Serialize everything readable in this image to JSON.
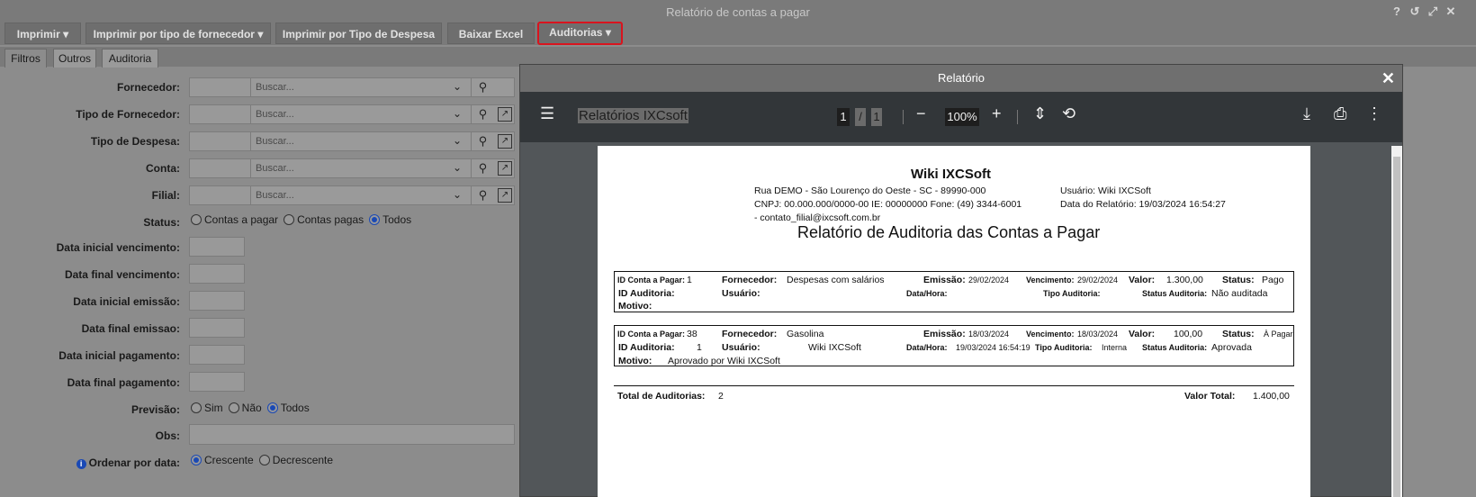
{
  "window": {
    "title": "Relatório de contas a pagar"
  },
  "toolbar": {
    "imprimir": "Imprimir",
    "imprimir_fornecedor": "Imprimir por tipo de fornecedor",
    "imprimir_despesa": "Imprimir por Tipo de Despesa",
    "baixar_excel": "Baixar Excel",
    "auditorias": "Auditorias"
  },
  "tabs": [
    "Filtros",
    "Outros",
    "Auditoria"
  ],
  "filters": {
    "fornecedor": "Fornecedor:",
    "tipo_fornecedor": "Tipo de Fornecedor:",
    "tipo_despesa": "Tipo de Despesa:",
    "conta": "Conta:",
    "filial": "Filial:",
    "placeholder": "Buscar...",
    "status": "Status:",
    "status_opts": [
      "Contas a pagar",
      "Contas pagas",
      "Todos"
    ],
    "data_ini_venc": "Data inicial vencimento:",
    "data_fin_venc": "Data final vencimento:",
    "data_ini_emis": "Data inicial emissão:",
    "data_fin_emis": "Data final emissao:",
    "data_ini_pag": "Data inicial pagamento:",
    "data_fin_pag": "Data final pagamento:",
    "previsao": "Previsão:",
    "previsao_opts": [
      "Sim",
      "Não",
      "Todos"
    ],
    "obs": "Obs:",
    "ordenar": "Ordenar por data:",
    "ordenar_opts": [
      "Crescente",
      "Decrescente"
    ]
  },
  "modal": {
    "title": "Relatório",
    "pdf_title": "Relatórios IXCsoft",
    "page_current": "1",
    "page_sep": "/",
    "page_total": "1",
    "zoom": "100%"
  },
  "report": {
    "company": "Wiki IXCSoft",
    "address": "Rua DEMO - São Lourenço do Oeste - SC - 89990-000",
    "cnpj": "CNPJ: 00.000.000/0000-00  IE: 00000000  Fone: (49) 3344-6001",
    "email": " - contato_filial@ixcsoft.com.br",
    "usuario": "Usuário: Wiki IXCSoft",
    "data_relatorio": "Data do Relatório: 19/03/2024 16:54:27",
    "heading": "Relatório de Auditoria das Contas a Pagar",
    "lbl_id_conta": "ID Conta a Pagar:",
    "lbl_fornecedor": "Fornecedor:",
    "lbl_emissao": "Emissão:",
    "lbl_vencimento": "Vencimento:",
    "lbl_valor": "Valor:",
    "lbl_status": "Status:",
    "lbl_id_auditoria": "ID Auditoria:",
    "lbl_usuario": "Usuário:",
    "lbl_datahora": "Data/Hora:",
    "lbl_tipo_auditoria": "Tipo Auditoria:",
    "lbl_status_auditoria": "Status Auditoria:",
    "lbl_motivo": "Motivo:",
    "records": [
      {
        "id": "1",
        "fornecedor": "Despesas com salários",
        "emissao": "29/02/2024",
        "vencimento": "29/02/2024",
        "valor": "1.300,00",
        "status": "Pago",
        "id_auditoria": "",
        "usuario": "",
        "datahora": "",
        "tipo": "",
        "status_auditoria": "Não auditada",
        "motivo": ""
      },
      {
        "id": "38",
        "fornecedor": "Gasolina",
        "emissao": "18/03/2024",
        "vencimento": "18/03/2024",
        "valor": "100,00",
        "status": "À Pagar",
        "id_auditoria": "1",
        "usuario": "Wiki IXCSoft",
        "datahora": "19/03/2024 16:54:19",
        "tipo": "Interna",
        "status_auditoria": "Aprovada",
        "motivo": "Aprovado por Wiki IXCSoft"
      }
    ],
    "lbl_total_auditorias": "Total de Auditorias:",
    "total_auditorias": "2",
    "lbl_valor_total": "Valor Total:",
    "valor_total": "1.400,00"
  }
}
